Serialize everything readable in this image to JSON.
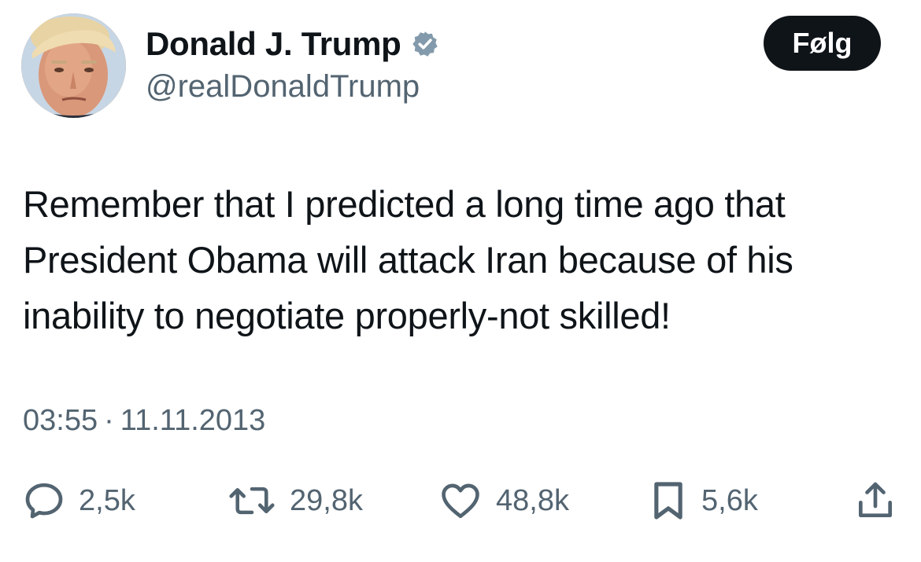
{
  "author": {
    "display_name": "Donald J. Trump",
    "handle": "@realDonaldTrump",
    "verified_icon": "verified-badge-icon",
    "avatar": "avatar"
  },
  "follow_button": {
    "label": "Følg"
  },
  "tweet": {
    "text": "Remember that I predicted a long time ago that President Obama will attack Iran because of his inability to negotiate properly-not skilled!",
    "time": "03:55",
    "separator": "·",
    "date": "11.11.2013"
  },
  "actions": {
    "reply": {
      "icon": "reply-icon",
      "count": "2,5k"
    },
    "retweet": {
      "icon": "retweet-icon",
      "count": "29,8k"
    },
    "like": {
      "icon": "heart-icon",
      "count": "48,8k"
    },
    "bookmark": {
      "icon": "bookmark-icon",
      "count": "5,6k"
    },
    "share": {
      "icon": "share-icon"
    }
  },
  "colors": {
    "text_primary": "#0f1419",
    "text_secondary": "#536471",
    "follow_bg": "#0f1419",
    "verified_badge": "#829aab"
  }
}
